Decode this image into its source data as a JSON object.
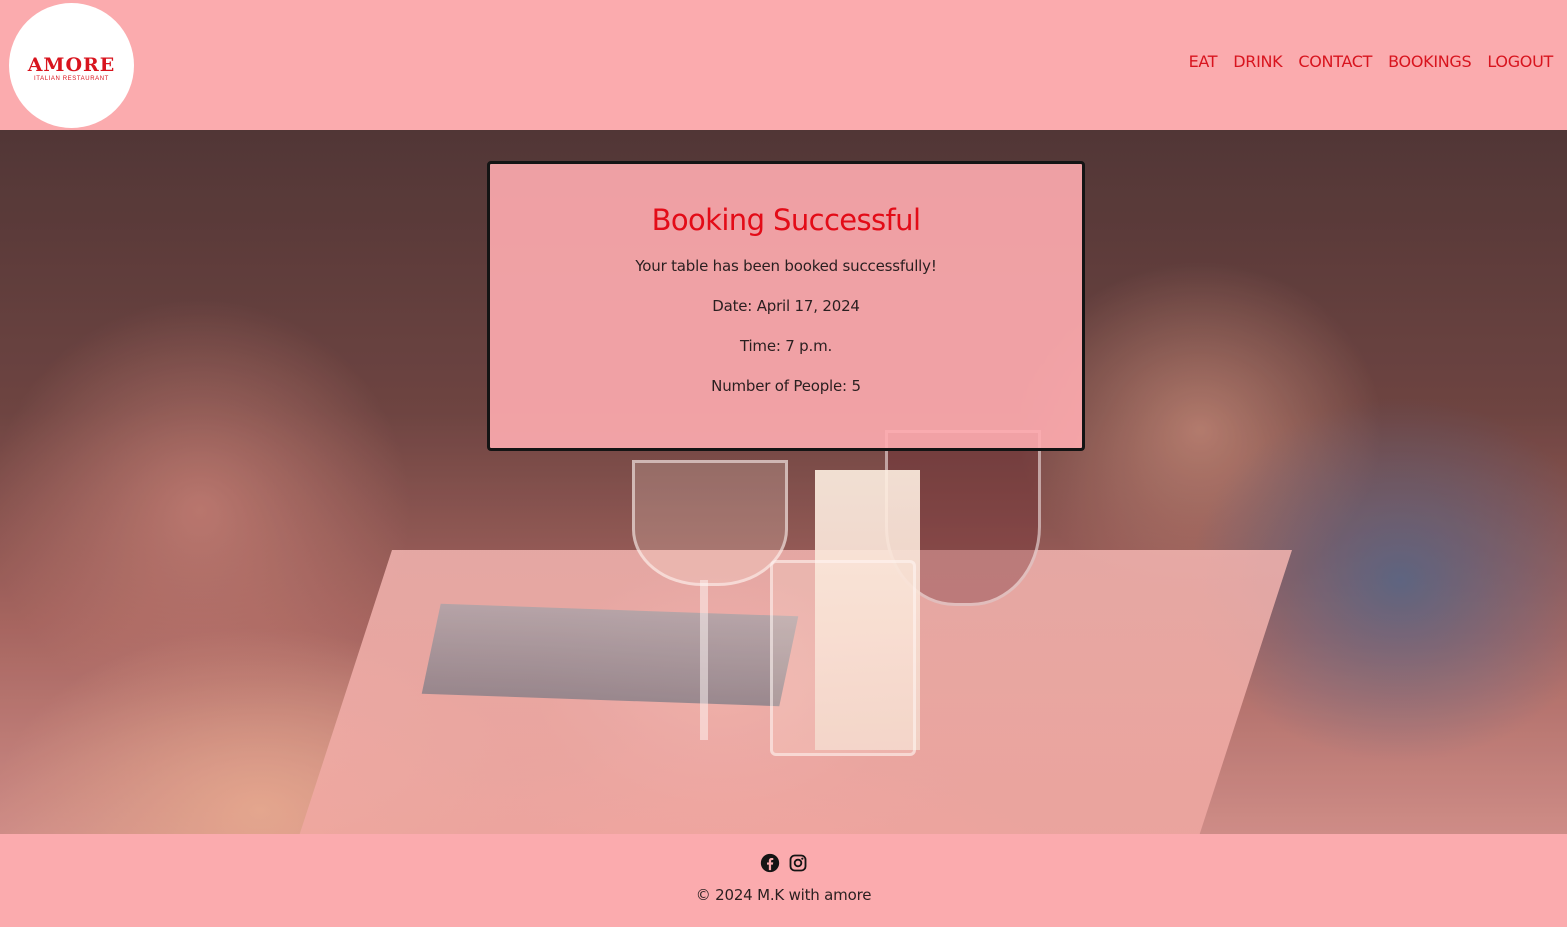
{
  "brand": {
    "name": "AMORE",
    "tagline": "ITALIAN RESTAURANT"
  },
  "nav": {
    "items": [
      {
        "label": "EAT"
      },
      {
        "label": "DRINK"
      },
      {
        "label": "CONTACT"
      },
      {
        "label": "BOOKINGS"
      },
      {
        "label": "LOGOUT"
      }
    ]
  },
  "booking": {
    "title": "Booking Successful",
    "message": "Your table has been booked successfully!",
    "date": "Date: April 17, 2024",
    "time": "Time: 7 p.m.",
    "people": "Number of People: 5"
  },
  "footer": {
    "social": [
      {
        "icon": "facebook-icon"
      },
      {
        "icon": "instagram-icon"
      }
    ],
    "copyright": "© 2024 M.K with amore"
  },
  "colors": {
    "header_bg": "#fbabae",
    "brand_red": "#d8141e",
    "title_red": "#e30b17",
    "card_border": "#141414"
  }
}
